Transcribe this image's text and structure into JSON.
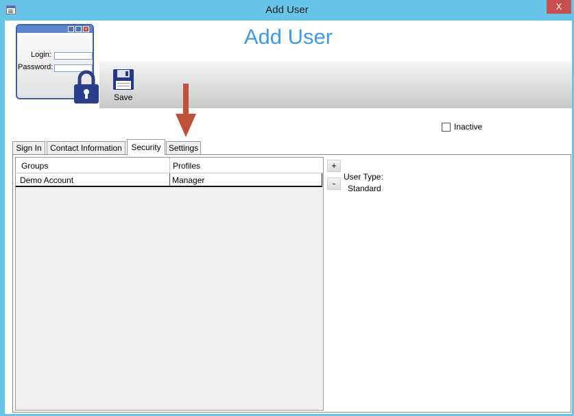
{
  "window": {
    "title": "Add User",
    "close_glyph": "X"
  },
  "header": {
    "title": "Add User"
  },
  "logo": {
    "login_label": "Login:",
    "password_label": "Password:"
  },
  "toolbar": {
    "save_label": "Save"
  },
  "form": {
    "inactive_label": "Inactive",
    "inactive_checked": false
  },
  "tabs": [
    {
      "label": "Sign In",
      "active": false
    },
    {
      "label": "Contact Information",
      "active": false
    },
    {
      "label": "Security",
      "active": true
    },
    {
      "label": "Settings",
      "active": false
    }
  ],
  "security": {
    "columns": [
      "Groups",
      "Profiles"
    ],
    "rows": [
      {
        "group": "Demo Account",
        "profile": "Manager"
      }
    ],
    "add_label": "+",
    "remove_label": "-",
    "user_type_label": "User Type:",
    "user_type_value": "Standard"
  },
  "icons": {
    "lock": "lock-icon",
    "save": "floppy-disk-icon",
    "arrow": "arrow-down-icon"
  },
  "colors": {
    "titlebar": "#65c4e8",
    "header_title": "#3d9bea",
    "arrow": "#c0503a",
    "close": "#c7504f",
    "lock": "#2a3e8c"
  }
}
